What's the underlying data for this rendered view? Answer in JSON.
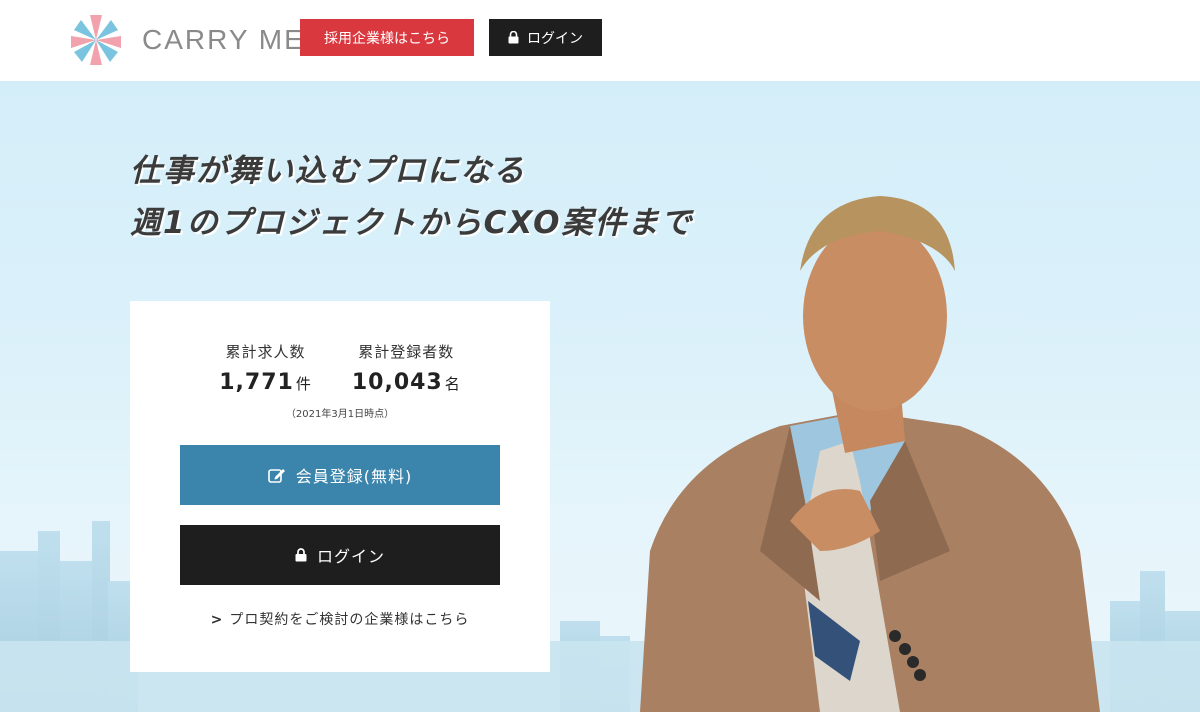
{
  "header": {
    "logo_text": "CARRY ME",
    "corp_button": "採用企業様はこちら",
    "login_button": "ログイン",
    "logo_colors": [
      "#f2a2ad",
      "#7ac4df"
    ]
  },
  "hero": {
    "headline_line1": "仕事が舞い込むプロになる",
    "headline_line2": "週1のプロジェクトからCXO案件まで"
  },
  "card": {
    "stats": [
      {
        "label": "累計求人数",
        "value": "1,771",
        "unit": "件"
      },
      {
        "label": "累計登録者数",
        "value": "10,043",
        "unit": "名"
      }
    ],
    "note": "（2021年3月1日時点）",
    "register_button": "会員登録(無料)",
    "login_button": "ログイン",
    "corp_link": "プロ契約をご検討の企業様はこちら"
  },
  "colors": {
    "brand_red": "#d9383f",
    "brand_blue": "#3b84ac",
    "dark": "#1e1e1e"
  }
}
